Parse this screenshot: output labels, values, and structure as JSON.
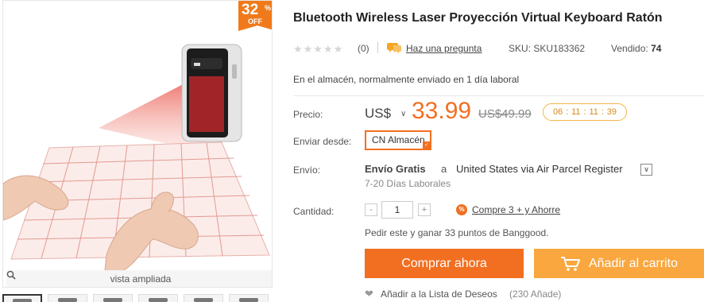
{
  "gallery": {
    "discount_percent": "32",
    "discount_sign": "%",
    "discount_off": "OFF",
    "zoom_label": "vista ampliada"
  },
  "product": {
    "title": "Bluetooth Wireless Laser Proyección Virtual Keyboard Ratón",
    "rating_count": "(0)",
    "ask_question": "Haz una pregunta",
    "sku_label": "SKU:",
    "sku_value": "SKU183362",
    "sold_label": "Vendido:",
    "sold_value": "74",
    "stock_status": "En el almacén, normalmente enviado en 1 día laboral"
  },
  "price": {
    "label": "Precio:",
    "currency": "US$",
    "current": "33.99",
    "old": "US$49.99",
    "countdown": [
      "06",
      "11",
      "11",
      "39"
    ],
    "countdown_sep": ":"
  },
  "shipping_from": {
    "label": "Enviar desde:",
    "selected": "CN Almacén"
  },
  "shipping": {
    "label": "Envío:",
    "method": "Envío Gratis",
    "to_word": "a",
    "destination": "United States via Air Parcel Register",
    "days": "7-20 Días Laborales"
  },
  "quantity": {
    "label": "Cantidad:",
    "minus": "-",
    "plus": "+",
    "value": "1",
    "bulk_badge": "%",
    "bulk_link": "Compre 3 + y Ahorre"
  },
  "points_text": "Pedir este y ganar 33 puntos de Banggood.",
  "actions": {
    "buy_now": "Comprar ahora",
    "add_to_cart": "Añadir al carrito",
    "wishlist": "Añadir a la Lista de Deseos",
    "wishlist_count": "(230 Añade)"
  },
  "colors": {
    "accent": "#f26f21",
    "cart": "#f9a73e",
    "countdown_border": "#f3b54b"
  }
}
